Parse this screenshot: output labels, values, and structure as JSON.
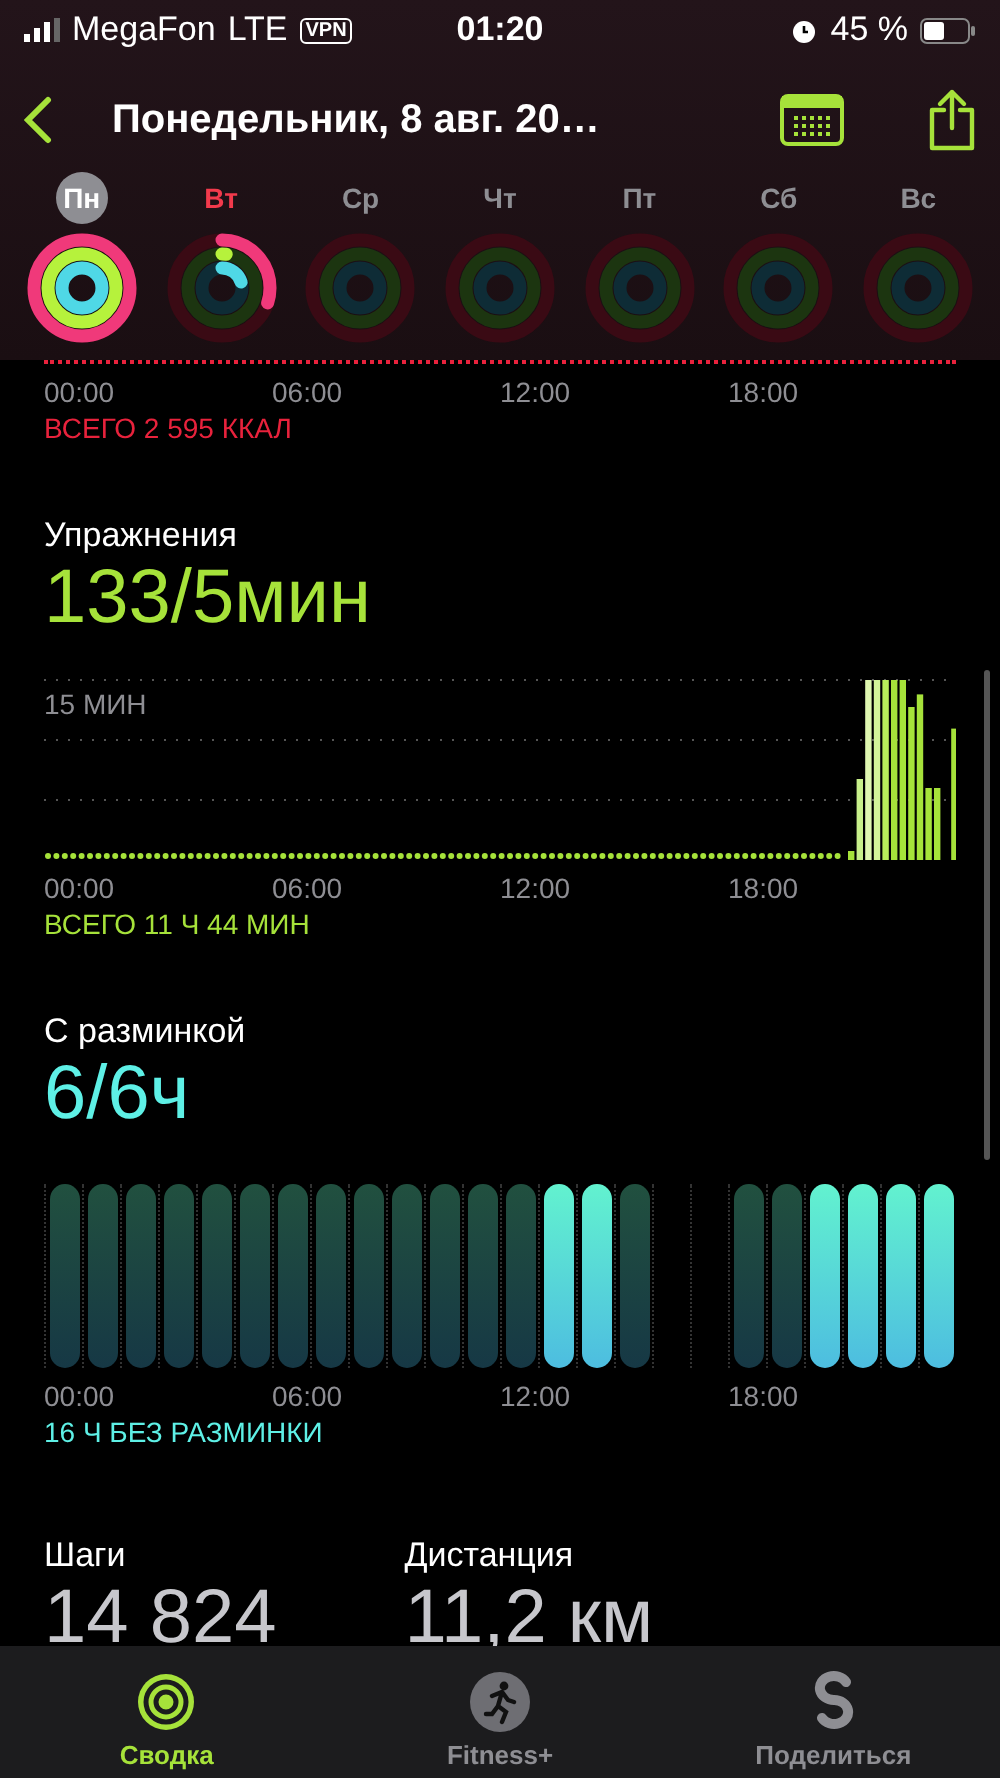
{
  "status_bar": {
    "carrier": "MegaFon",
    "network": "LTE",
    "vpn": "VPN",
    "time": "01:20",
    "battery": "45 %"
  },
  "title": "Понедельник, 8 авг. 20…",
  "days": [
    {
      "label": "Пн",
      "selected": true,
      "today": false,
      "kind": "closed"
    },
    {
      "label": "Вт",
      "selected": false,
      "today": true,
      "kind": "partial"
    },
    {
      "label": "Ср",
      "selected": false,
      "today": false,
      "kind": "empty"
    },
    {
      "label": "Чт",
      "selected": false,
      "today": false,
      "kind": "empty"
    },
    {
      "label": "Пт",
      "selected": false,
      "today": false,
      "kind": "empty"
    },
    {
      "label": "Сб",
      "selected": false,
      "today": false,
      "kind": "empty"
    },
    {
      "label": "Вс",
      "selected": false,
      "today": false,
      "kind": "empty"
    }
  ],
  "move": {
    "xticks": [
      "00:00",
      "06:00",
      "12:00",
      "18:00"
    ],
    "total": "ВСЕГО 2 595 ККАЛ"
  },
  "exercise": {
    "title": "Упражнения",
    "value": "133/5мин",
    "grid_label": "15 МИН",
    "xticks": [
      "00:00",
      "06:00",
      "12:00",
      "18:00"
    ],
    "total": "ВСЕГО 11 Ч 44 МИН"
  },
  "stand": {
    "title": "С разминкой",
    "value": "6/6ч",
    "hours": [
      {
        "kind": "hour",
        "stood": false
      },
      {
        "kind": "hour",
        "stood": false
      },
      {
        "kind": "hour",
        "stood": false
      },
      {
        "kind": "hour",
        "stood": false
      },
      {
        "kind": "hour",
        "stood": false
      },
      {
        "kind": "hour",
        "stood": false
      },
      {
        "kind": "hour",
        "stood": false
      },
      {
        "kind": "hour",
        "stood": false
      },
      {
        "kind": "hour",
        "stood": false
      },
      {
        "kind": "hour",
        "stood": false
      },
      {
        "kind": "hour",
        "stood": false
      },
      {
        "kind": "hour",
        "stood": false
      },
      {
        "kind": "hour",
        "stood": false
      },
      {
        "kind": "hour",
        "stood": true
      },
      {
        "kind": "hour",
        "stood": true
      },
      {
        "kind": "hour",
        "stood": false
      },
      {
        "kind": "gap"
      },
      {
        "kind": "gap"
      },
      {
        "kind": "hour",
        "stood": false
      },
      {
        "kind": "hour",
        "stood": false
      },
      {
        "kind": "hour",
        "stood": true
      },
      {
        "kind": "hour",
        "stood": true
      },
      {
        "kind": "hour",
        "stood": true
      },
      {
        "kind": "hour",
        "stood": true
      }
    ],
    "xticks": [
      "00:00",
      "06:00",
      "12:00",
      "18:00"
    ],
    "total": "16 Ч БЕЗ РАЗМИНКИ"
  },
  "stats": [
    {
      "label": "Шаги",
      "value": "14 824"
    },
    {
      "label": "Дистанция",
      "value": "11,2 км"
    }
  ],
  "tabs": [
    {
      "label": "Сводка",
      "kind": "summary",
      "selected": true
    },
    {
      "label": "Fitness+",
      "kind": "fitness",
      "selected": false
    },
    {
      "label": "Поделиться",
      "kind": "sharing",
      "selected": false
    }
  ]
}
